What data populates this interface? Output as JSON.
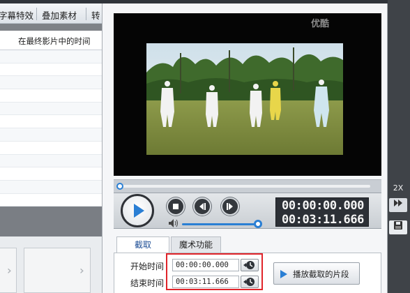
{
  "background_window": {
    "tabs": [
      "字幕特效",
      "叠加素材",
      "转"
    ],
    "column_header": "在最终影片中的时间",
    "right_strip_label": "2X"
  },
  "dialog": {
    "video": {
      "watermark": "优酷"
    },
    "playback": {
      "seek_progress": 0.0,
      "volume_level": 1.0,
      "current_time": "00:00:00.000",
      "total_time": "00:03:11.666"
    },
    "tabs": [
      {
        "label": "截取",
        "active": true
      },
      {
        "label": "魔术功能",
        "active": false
      }
    ],
    "trim": {
      "start_label": "开始时间",
      "start_value": "00:00:00.000",
      "end_label": "结束时间",
      "end_value": "00:03:11.666",
      "play_segment_label": "播放截取的片段"
    }
  },
  "colors": {
    "accent_blue": "#2a7fd4",
    "highlight_red": "#e0242a",
    "time_display_bg": "#2c3036"
  }
}
